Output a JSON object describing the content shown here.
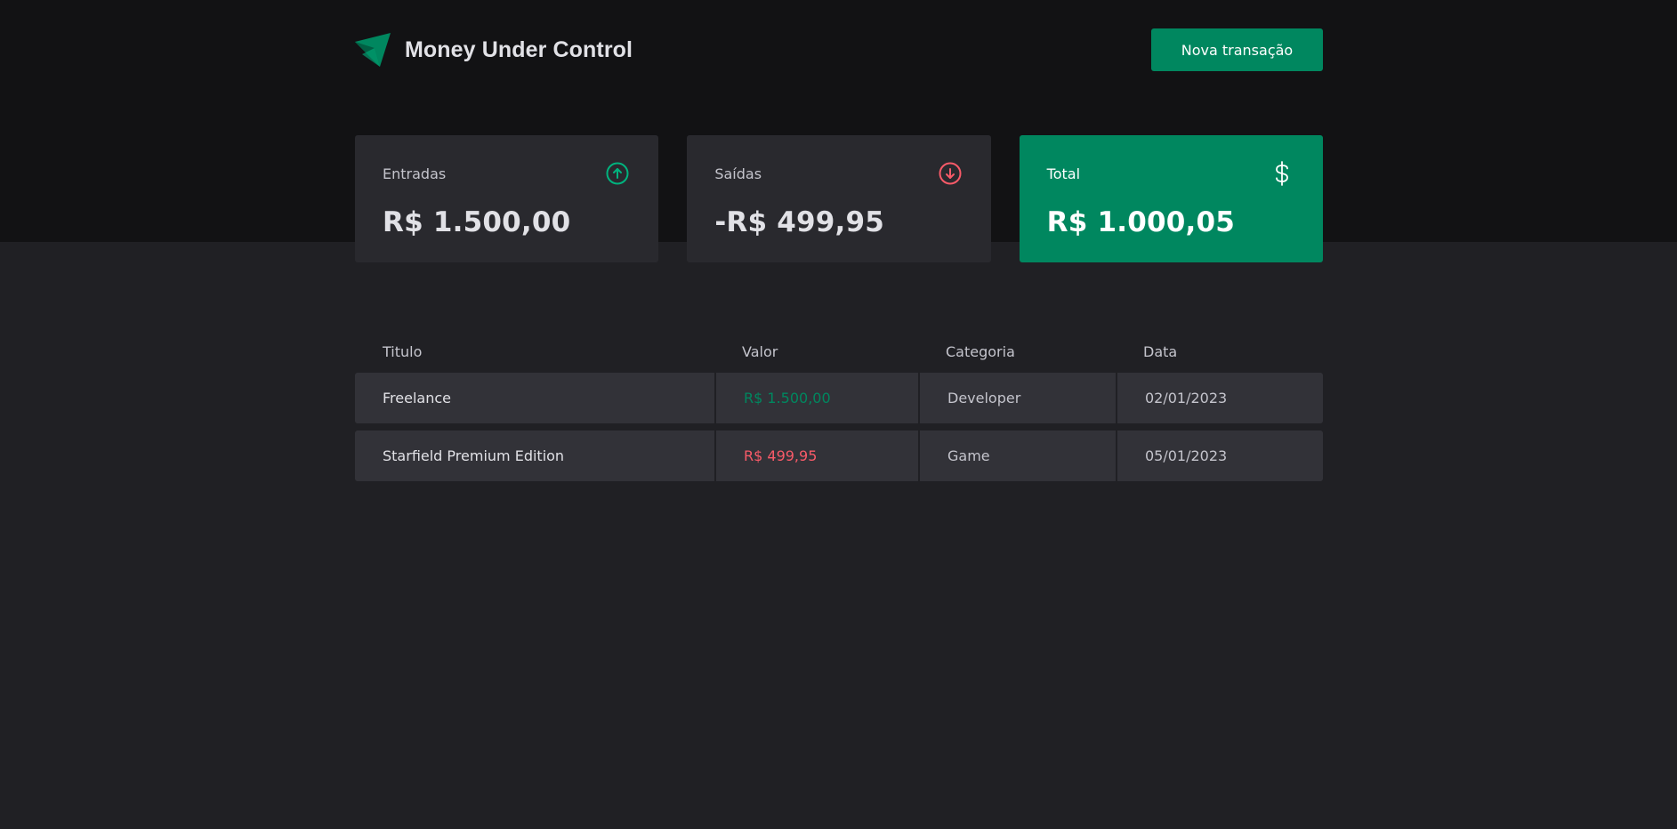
{
  "colors": {
    "brand": "#00875f",
    "income": "#00b37e",
    "outcome": "#f75a68",
    "header_bg": "#121214",
    "page_bg": "#202024",
    "card_bg": "#29292e",
    "row_bg": "#323238"
  },
  "header": {
    "logo_icon": "paper-plane-logo",
    "title": "Money Under Control",
    "new_transaction_label": "Nova transação"
  },
  "summary": {
    "income": {
      "label": "Entradas",
      "value": "R$ 1.500,00",
      "icon": "arrow-circle-up-icon"
    },
    "outcome": {
      "label": "Saídas",
      "value": "-R$ 499,95",
      "icon": "arrow-circle-down-icon"
    },
    "total": {
      "label": "Total",
      "value": "R$ 1.000,05",
      "icon": "dollar-sign-icon"
    }
  },
  "table": {
    "headers": [
      "Titulo",
      "Valor",
      "Categoria",
      "Data"
    ],
    "rows": [
      {
        "title": "Freelance",
        "value": "R$ 1.500,00",
        "type": "income",
        "category": "Developer",
        "date": "02/01/2023"
      },
      {
        "title": "Starfield Premium Edition",
        "value": "R$ 499,95",
        "type": "outcome",
        "category": "Game",
        "date": "05/01/2023"
      }
    ]
  }
}
